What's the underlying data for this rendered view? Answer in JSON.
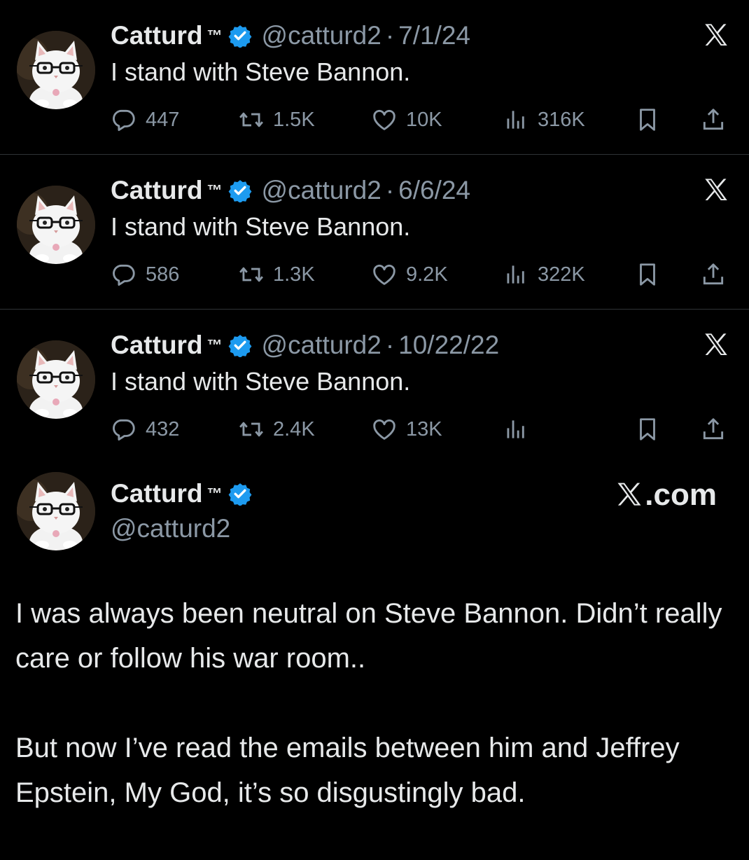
{
  "tweets": [
    {
      "name": "Catturd",
      "tm": "™",
      "handle": "@catturd2",
      "separator": "·",
      "date": "7/1/24",
      "text": "I stand with Steve Bannon.",
      "replies": "447",
      "reposts": "1.5K",
      "likes": "10K",
      "views": "316K"
    },
    {
      "name": "Catturd",
      "tm": "™",
      "handle": "@catturd2",
      "separator": "·",
      "date": "6/6/24",
      "text": "I stand with Steve Bannon.",
      "replies": "586",
      "reposts": "1.3K",
      "likes": "9.2K",
      "views": "322K"
    },
    {
      "name": "Catturd",
      "tm": "™",
      "handle": "@catturd2",
      "separator": "·",
      "date": "10/22/22",
      "text": "I stand with Steve Bannon.",
      "replies": "432",
      "reposts": "2.4K",
      "likes": "13K",
      "views": ""
    }
  ],
  "quote": {
    "name": "Catturd",
    "tm": "™",
    "handle": "@catturd2",
    "site_label": ".com",
    "paragraph_1": "I was always been neutral on Steve Bannon. Didn’t really care or follow his war room..",
    "paragraph_2": "But now I’ve read the emails between him and Jeffrey Epstein, My God, it’s so disgustingly bad."
  },
  "colors": {
    "background": "#000000",
    "text": "#e7e9ea",
    "muted": "#8b98a5",
    "verified": "#1d9bf0",
    "divider": "#2f3336"
  },
  "icons": [
    "avatar-cat-photo",
    "verified-badge-icon",
    "x-logo-icon",
    "reply-icon",
    "repost-icon",
    "like-icon",
    "views-icon",
    "bookmark-icon",
    "share-icon"
  ]
}
